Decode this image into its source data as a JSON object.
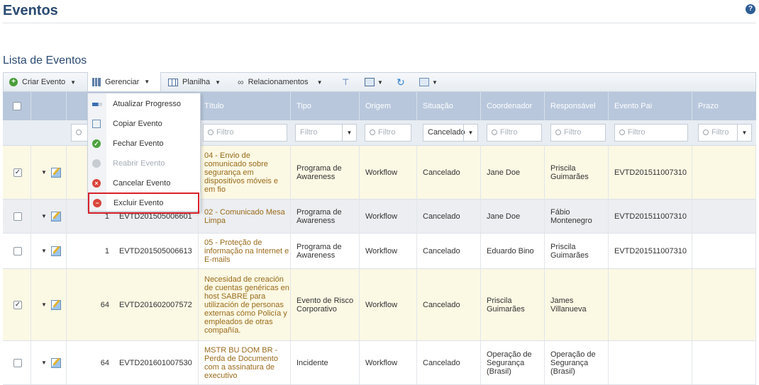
{
  "page": {
    "title": "Eventos",
    "section_title": "Lista de Eventos"
  },
  "toolbar": {
    "create_label": "Criar Evento",
    "manage_label": "Gerenciar",
    "sheet_label": "Planilha",
    "relations_label": "Relacionamentos"
  },
  "columns": [
    "Título",
    "Tipo",
    "Origem",
    "Situação",
    "Coordenador",
    "Responsável",
    "Evento Pai",
    "Prazo"
  ],
  "filters": {
    "placeholder": "Filtro",
    "situation_selected": "Cancelado"
  },
  "menu": {
    "items": [
      {
        "label": "Atualizar Progresso",
        "icon": "progress-bar-icon",
        "enabled": true
      },
      {
        "label": "Copiar Evento",
        "icon": "copy-icon",
        "enabled": true
      },
      {
        "label": "Fechar Evento",
        "icon": "check-circle-icon",
        "enabled": true
      },
      {
        "label": "Reabrir Evento",
        "icon": "key-icon",
        "enabled": false
      },
      {
        "label": "Cancelar Evento",
        "icon": "cancel-circle-icon",
        "enabled": true
      },
      {
        "label": "Excluir Evento",
        "icon": "delete-circle-icon",
        "enabled": true
      }
    ]
  },
  "rows": [
    {
      "checked": true,
      "count": "",
      "id": "",
      "title": "04 - Envio de comunicado sobre segurança em dispositivos móveis e em fio",
      "type": "Programa de Awareness",
      "origin": "Workflow",
      "situation": "Cancelado",
      "coordinator": "Jane Doe",
      "responsible": "Priscila Guimarães",
      "parent": "EVTD201511007310",
      "deadline": ""
    },
    {
      "checked": false,
      "count": "1",
      "id": "EVTD201505006601",
      "title": "02 - Comunicado Mesa Limpa",
      "type": "Programa de Awareness",
      "origin": "Workflow",
      "situation": "Cancelado",
      "coordinator": "Jane Doe",
      "responsible": "Fábio Montenegro",
      "parent": "EVTD201511007310",
      "deadline": ""
    },
    {
      "checked": false,
      "count": "1",
      "id": "EVTD201505006613",
      "title": "05 - Proteção de informação na Internet e E-mails",
      "type": "Programa de Awareness",
      "origin": "Workflow",
      "situation": "Cancelado",
      "coordinator": "Eduardo Bino",
      "responsible": "Priscila Guimarães",
      "parent": "EVTD201511007310",
      "deadline": ""
    },
    {
      "checked": true,
      "count": "64",
      "id": "EVTD201602007572",
      "title": "Necesidad de creación de cuentas genéricas en host SABRE para utilización de personas externas cómo Policía y empleados de otras compañía.",
      "type": "Evento de Risco Corporativo",
      "origin": "Workflow",
      "situation": "Cancelado",
      "coordinator": "Priscila Guimarães",
      "responsible": "James Villanueva",
      "parent": "",
      "deadline": ""
    },
    {
      "checked": false,
      "count": "64",
      "id": "EVTD201601007530",
      "title": "MSTR BU DOM BR - Perda de Documento com a assinatura de executivo",
      "type": "Incidente",
      "origin": "Workflow",
      "situation": "Cancelado",
      "coordinator": "Operação de Segurança (Brasil)",
      "responsible": "Operação de Segurança (Brasil)",
      "parent": "",
      "deadline": ""
    }
  ]
}
